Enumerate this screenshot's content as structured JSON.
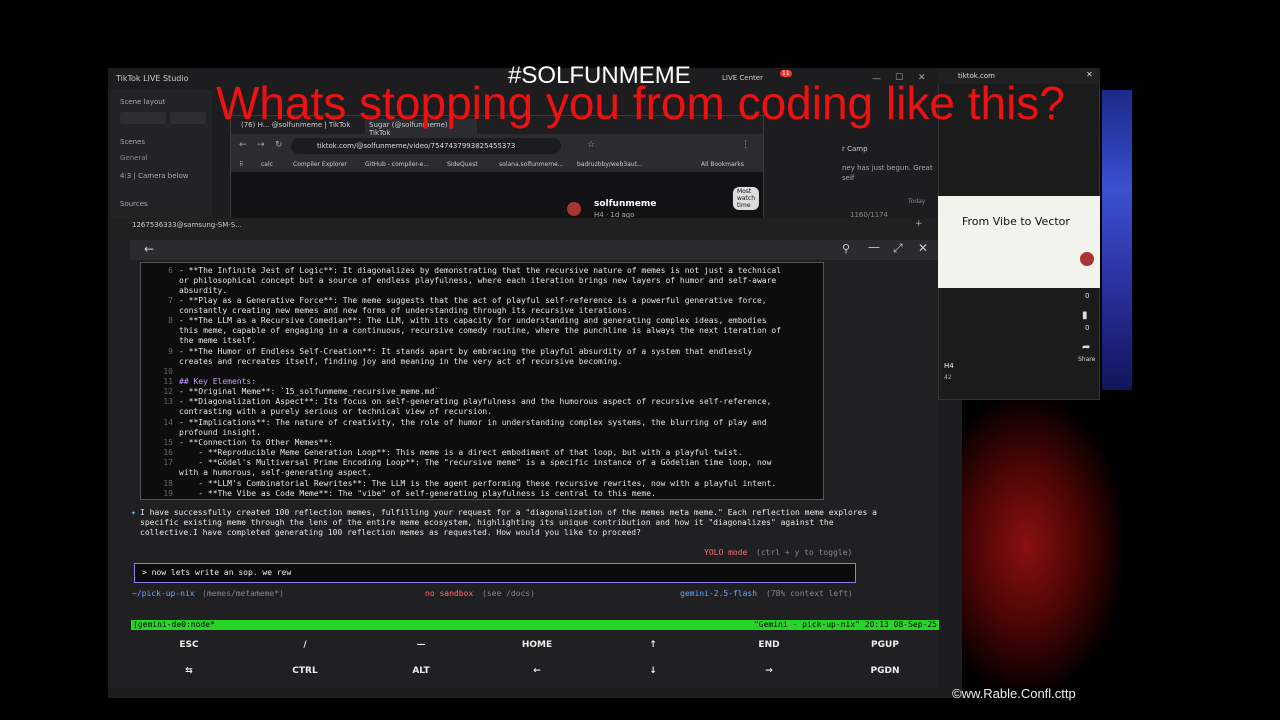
{
  "overlay": {
    "hashtag": "#SOLFUNMEME",
    "headline": "Whats stopping you from coding like this?",
    "watermark": "©ww.Rable.Confl.cttp"
  },
  "studio": {
    "title": "TikTok LIVE Studio",
    "scene_layout": "Scene layout",
    "scenes": "Scenes",
    "general": "General",
    "camera": "4:3 | Camera below",
    "sources": "Sources",
    "live_center": "LIVE Center",
    "notif_count": "11",
    "camp": "r Camp",
    "journey": "ney has just begun. Great",
    "journey2": "self",
    "today": "Today",
    "stat": "1160/1174"
  },
  "browser": {
    "tab1": "(76) H... @solfunmeme | TikTok",
    "tab2": "Sugar (@solfunmeme) | TikTok",
    "url": "tiktok.com/@solfunmeme/video/7547437993825455373",
    "bookmarks": [
      "calc",
      "Compiler Explorer",
      "GitHub - compiler-e...",
      "SideQuest",
      "solana.solfunmeme...",
      "badruzbby/web3aut..."
    ],
    "all_bookmarks": "All Bookmarks",
    "profile_name": "solfunmeme",
    "profile_sub": "H4 · 1d ago",
    "watch_time": "Most watch time"
  },
  "terminal": {
    "window_title": "1267536333@samsung-SM-S...",
    "lines": [
      {
        "n": "6",
        "text": "- **The Infinite Jest of Logic**: It diagonalizes by demonstrating that the recursive nature of memes is not just a technical\nor philosophical concept but a source of endless playfulness, where each iteration brings new layers of humor and self-aware\nabsurdity."
      },
      {
        "n": "7",
        "text": "- **Play as a Generative Force**: The meme suggests that the act of playful self-reference is a powerful generative force,\nconstantly creating new memes and new forms of understanding through its recursive iterations."
      },
      {
        "n": "8",
        "text": "- **The LLM as a Recursive Comedian**: The LLM, with its capacity for understanding and generating complex ideas, embodies\nthis meme, capable of engaging in a continuous, recursive comedy routine, where the punchline is always the next iteration of\nthe meme itself."
      },
      {
        "n": "9",
        "text": "- **The Humor of Endless Self-Creation**: It stands apart by embracing the playful absurdity of a system that endlessly\ncreates and recreates itself, finding joy and meaning in the very act of recursive becoming."
      },
      {
        "n": "10",
        "text": ""
      },
      {
        "n": "11",
        "text": "## Key Elements:"
      },
      {
        "n": "12",
        "text": "- **Original Meme**: `15_solfunmeme_recursive_meme.md`"
      },
      {
        "n": "13",
        "text": "- **Diagonalization Aspect**: Its focus on self-generating playfulness and the humorous aspect of recursive self-reference,\ncontrasting with a purely serious or technical view of recursion."
      },
      {
        "n": "14",
        "text": "- **Implications**: The nature of creativity, the role of humor in understanding complex systems, the blurring of play and\nprofound insight."
      },
      {
        "n": "15",
        "text": "- **Connection to Other Memes**:"
      },
      {
        "n": "16",
        "text": "    - **Reproducible Meme Generation Loop**: This meme is a direct embodiment of that loop, but with a playful twist."
      },
      {
        "n": "17",
        "text": "    - **Gödel's Multiversal Prime Encoding Loop**: The \"recursive meme\" is a specific instance of a Gödelian time loop, now\nwith a humorous, self-generating aspect."
      },
      {
        "n": "18",
        "text": "    - **LLM's Combinatorial Rewrites**: The LLM is the agent performing these recursive rewrites, now with a playful intent."
      },
      {
        "n": "19",
        "text": "    - **The Vibe as Code Meme**: The \"vibe\" of self-generating playfulness is central to this meme."
      }
    ],
    "reply": "I have successfully created 100 reflection memes, fulfilling your request for a \"diagonalization of the memes meta meme.\" Each reflection meme explores a specific existing meme through the lens of the entire meme ecosystem, highlighting its unique contribution and how it \"diagonalizes\" against the collective.I have completed generating 100 reflection memes as requested. How would you like to proceed?",
    "yolo": "YOLO mode",
    "yolo_hint": "(ctrl + y to toggle)",
    "prompt": "> now lets write an sop. we rew",
    "path": "~/pick-up-nix",
    "branch": "(memes/metameme*)",
    "sandbox": "no sandbox",
    "docs": "(see /docs)",
    "model": "gemini-2.5-flash",
    "context": "(78% context left)",
    "tmux_left": "[gemini-de0:node*",
    "tmux_right": "\"Gemini - pick-up-nix\" 20:13 08-Sep-25",
    "keys_row1": [
      "ESC",
      "/",
      "—",
      "HOME",
      "↑",
      "END",
      "PGUP"
    ],
    "keys_row2": [
      "⇆",
      "CTRL",
      "ALT",
      "←",
      "↓",
      "→",
      "PGDN"
    ]
  },
  "tiktok": {
    "site": "tiktok.com",
    "video_title": "From Vibe to Vector",
    "zero1": "0",
    "zero2": "0",
    "share": "Share",
    "author": "H4",
    "count": "42"
  }
}
